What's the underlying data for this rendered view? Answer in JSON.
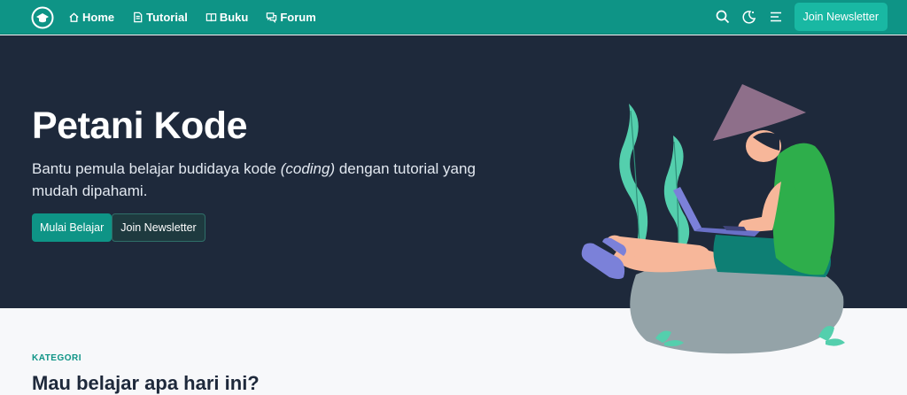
{
  "nav": {
    "links": [
      {
        "label": "Home",
        "icon": "home-icon"
      },
      {
        "label": "Tutorial",
        "icon": "document-icon"
      },
      {
        "label": "Buku",
        "icon": "book-icon"
      },
      {
        "label": "Forum",
        "icon": "chat-icon"
      }
    ],
    "newsletter_label": "Join Newsletter"
  },
  "hero": {
    "title": "Petani Kode",
    "desc_pre": "Bantu pemula belajar budidaya kode ",
    "desc_em": "(coding)",
    "desc_post": " dengan tutorial yang mudah dipahami.",
    "cta_primary": "Mulai Belajar",
    "cta_secondary": "Join Newsletter"
  },
  "section": {
    "eyebrow": "KATEGORI",
    "title": "Mau belajar apa hari ini?"
  },
  "colors": {
    "brand": "#0e9486",
    "hero_bg": "#1e293b",
    "accent": "#19b8a3"
  }
}
